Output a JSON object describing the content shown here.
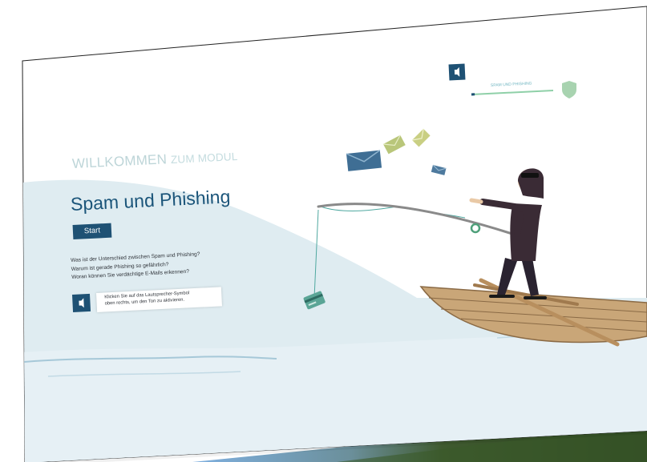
{
  "header": {
    "progress_label": "SPAM UND PHISHING",
    "progress_fraction": 0.04
  },
  "intro": {
    "kicker_strong": "WILLKOMMEN",
    "kicker_light": "ZUM MODUL",
    "title": "Spam und Phishing",
    "start_label": "Start",
    "questions": [
      "Was ist der Unterschied zwischen Spam und Phishing?",
      "Warum ist gerade Phishing so gefährlich?",
      "Woran können Sie verdächtige E-Mails erkennen?"
    ],
    "hint_lines": [
      "Klicken Sie auf das Lautsprecher-Symbol",
      "oben rechts, um den Ton zu aktivieren."
    ]
  },
  "colors": {
    "accent": "#1e5174",
    "water": "#dfecf1",
    "sea_light": "#e9f2f6",
    "shield": "#a8d3b0",
    "progress_track": "#8fd0a8"
  },
  "icons": [
    "speaker-icon",
    "shield-icon",
    "envelope-icon",
    "credit-card-icon"
  ]
}
